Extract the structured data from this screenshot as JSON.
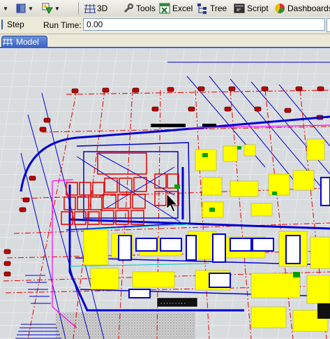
{
  "toolbar": {
    "view3d_label": "3D",
    "tools_label": "Tools",
    "excel_label": "Excel",
    "tree_label": "Tree",
    "script_label": "Script",
    "dashboards_label": "Dashboards",
    "icons": [
      "dropdown-arrow",
      "panel-icon",
      "tool-icon",
      "grid-3d-icon",
      "tools-icon",
      "excel-icon",
      "tree-icon",
      "script-icon",
      "dashboards-icon"
    ]
  },
  "runbar": {
    "step_label": "Step",
    "run_time_label": "Run Time:",
    "run_time_value": "0.00"
  },
  "tabs": [
    {
      "label": "Model"
    }
  ],
  "colors": {
    "tab_active": "#3a63c4",
    "cad_red": "#e00000",
    "cad_blue": "#0000d0",
    "cad_yellow": "#ffff00",
    "cad_magenta": "#ff00ff",
    "floor": "#d9dcdf"
  },
  "model_view": {
    "tag_text": "·········"
  }
}
